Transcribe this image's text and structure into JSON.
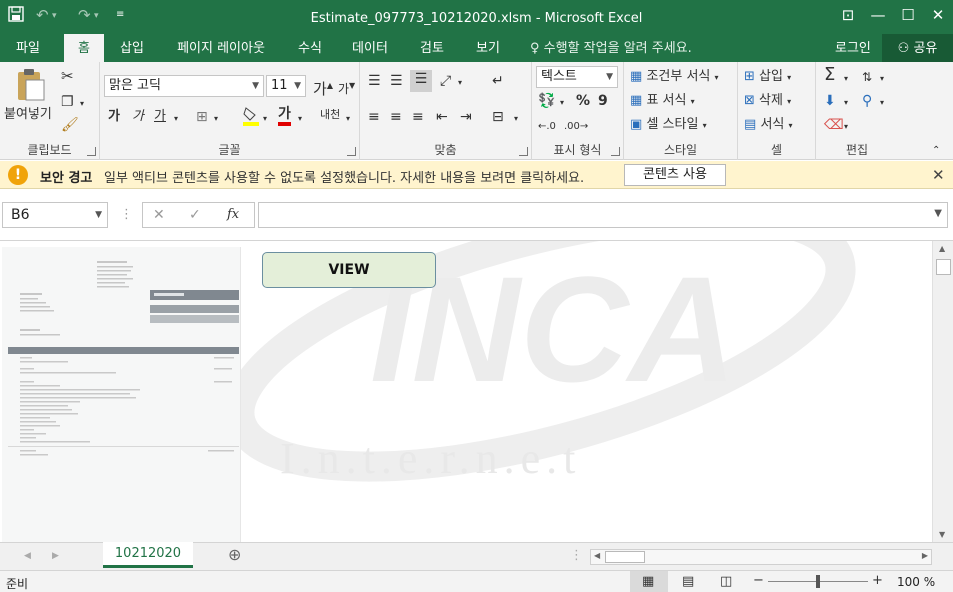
{
  "title": "Estimate_097773_10212020.xlsm - Microsoft Excel",
  "colors": {
    "brand": "#217346",
    "accent": "#185a35",
    "warning_bg": "#fff4ce",
    "warning_icon": "#f0a30a"
  },
  "quick_access": {
    "save_icon": "save-icon",
    "undo_icon": "undo-icon",
    "redo_icon": "redo-icon",
    "customize_icon": "customize-icon"
  },
  "window_controls": {
    "ribbon_display": "⊡",
    "minimize": "—",
    "maximize": "☐",
    "close": "✕"
  },
  "tabs": [
    {
      "label": "파일"
    },
    {
      "label": "홈"
    },
    {
      "label": "삽입"
    },
    {
      "label": "페이지 레이아웃"
    },
    {
      "label": "수식"
    },
    {
      "label": "데이터"
    },
    {
      "label": "검토"
    },
    {
      "label": "보기"
    }
  ],
  "tell_me": "수행할 작업을 알려 주세요.",
  "login": "로그인",
  "share": "공유",
  "ribbon": {
    "clipboard": {
      "label": "클립보드",
      "paste": "붙여넣기"
    },
    "font": {
      "label": "글꼴",
      "name": "맑은 고딕",
      "size": "11",
      "bold": "가",
      "italic": "가",
      "underline": "가",
      "grow": "가",
      "shrink": "가",
      "font_color": "가",
      "phonetic": "내천"
    },
    "alignment": {
      "label": "맞춤"
    },
    "number": {
      "label": "표시 형식",
      "format": "텍스트",
      "percent": "%",
      "comma": "9"
    },
    "styles": {
      "label": "스타일",
      "conditional": "조건부 서식",
      "table": "표 서식",
      "cell": "셀 스타일"
    },
    "cells": {
      "label": "셀",
      "insert": "삽입",
      "delete": "삭제",
      "format": "서식"
    },
    "editing": {
      "label": "편집"
    }
  },
  "security_bar": {
    "title": "보안 경고",
    "message": "일부 액티브 콘텐츠를 사용할 수 없도록 설정했습니다. 자세한 내용을 보려면 클릭하세요.",
    "button": "콘텐츠 사용"
  },
  "formula_bar": {
    "name_box": "B6",
    "cancel": "✕",
    "enter": "✓",
    "fx": "fx",
    "value": ""
  },
  "content": {
    "view_button": "VIEW",
    "watermark_logo": "INCA",
    "watermark_text": "I.n.t.e.r.n.e.t"
  },
  "sheet_tabs": [
    {
      "label": "10212020"
    }
  ],
  "status": {
    "ready": "준비",
    "zoom": "100 %",
    "zoom_level_percent": 100
  }
}
